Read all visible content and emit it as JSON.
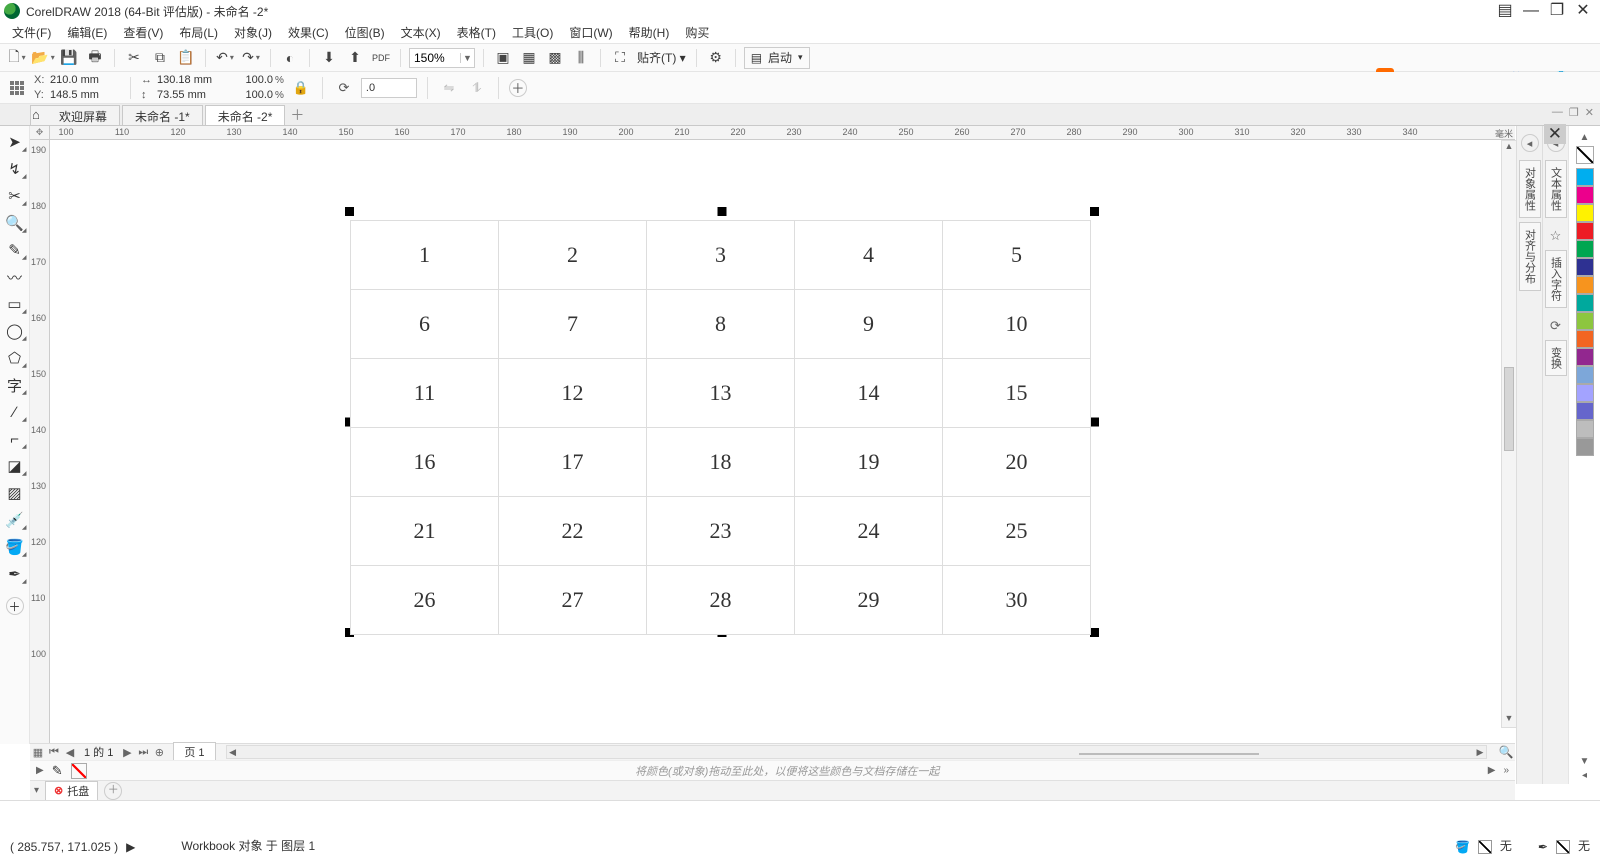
{
  "title": "CorelDRAW 2018 (64-Bit 评估版) - 未命名 -2*",
  "menus": [
    "文件(F)",
    "编辑(E)",
    "查看(V)",
    "布局(L)",
    "对象(J)",
    "效果(C)",
    "位图(B)",
    "文本(X)",
    "表格(T)",
    "工具(O)",
    "窗口(W)",
    "帮助(H)",
    "购买"
  ],
  "toolbar1": {
    "zoom": "150%",
    "paste_label": "贴齐(T)",
    "launch_label": "启动"
  },
  "prop": {
    "x_label": "X:",
    "y_label": "Y:",
    "x": "210.0 mm",
    "y": "148.5 mm",
    "w": "130.18 mm",
    "h": "73.55 mm",
    "sx": "100.0",
    "sy": "100.0",
    "pct": "%",
    "rot": ".0"
  },
  "tabs": {
    "welcome": "欢迎屏幕",
    "doc1": "未命名 -1*",
    "doc2": "未命名 -2*"
  },
  "ruler": {
    "unit": "毫米",
    "h_ticks": [
      100,
      110,
      120,
      130,
      140,
      150,
      160,
      170,
      180,
      190,
      200,
      210,
      220,
      230,
      240,
      250,
      260,
      270,
      280,
      290,
      300,
      310,
      320,
      330,
      340
    ],
    "v_ticks": [
      190,
      180,
      170,
      160,
      150,
      140,
      130,
      120,
      110,
      100
    ]
  },
  "table": {
    "rows": 6,
    "cols": 5,
    "cells": [
      [
        "1",
        "2",
        "3",
        "4",
        "5"
      ],
      [
        "6",
        "7",
        "8",
        "9",
        "10"
      ],
      [
        "11",
        "12",
        "13",
        "14",
        "15"
      ],
      [
        "16",
        "17",
        "18",
        "19",
        "20"
      ],
      [
        "21",
        "22",
        "23",
        "24",
        "25"
      ],
      [
        "26",
        "27",
        "28",
        "29",
        "30"
      ]
    ]
  },
  "dockers": {
    "a": [
      "对象属性",
      "对齐与分布"
    ],
    "b": [
      "文本属性",
      "插入字符",
      "变换"
    ]
  },
  "palette_colors": [
    "#00AEEF",
    "#EC008C",
    "#FFF200",
    "#ED1C24",
    "#00A651",
    "#2E3192",
    "#F7941E",
    "#00A99D",
    "#8DC63F",
    "#F26522",
    "#92278F",
    "#7DA7D9",
    "#A3A3FF",
    "#6666CC",
    "#BDBDBD",
    "#999999"
  ],
  "pagenav": {
    "info": "1 的 1",
    "page_tab": "页 1"
  },
  "colorwell_hint": "将颜色(或对象)拖动至此处，以便将这些颜色与文档存储在一起",
  "tray_label": "托盘",
  "status": {
    "coords": "( 285.757, 171.025 )",
    "objinfo": "Workbook 对象 于 图层 1",
    "fill_none": "无",
    "outline_none": "无"
  }
}
